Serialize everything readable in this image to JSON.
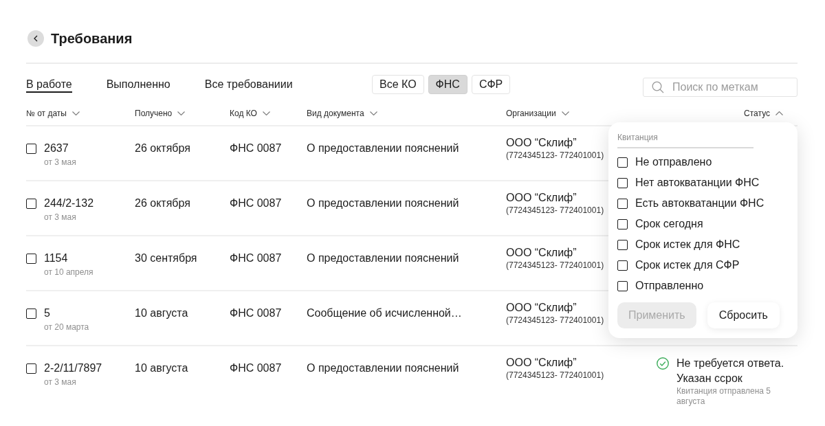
{
  "page": {
    "title": "Требования"
  },
  "tabs": [
    {
      "label": "В работе",
      "selected": true
    },
    {
      "label": "Выполненно",
      "selected": false
    },
    {
      "label": "Все требованиии",
      "selected": false
    }
  ],
  "authority_filter": [
    {
      "label": "Все КО",
      "selected": false
    },
    {
      "label": "ФНС",
      "selected": true
    },
    {
      "label": "СФР",
      "selected": false
    }
  ],
  "search": {
    "placeholder": "Поиск по меткам"
  },
  "table": {
    "columns": [
      {
        "label": "№ от даты",
        "expanded": false
      },
      {
        "label": "Получено",
        "expanded": false
      },
      {
        "label": "Код КО",
        "expanded": false
      },
      {
        "label": "Вид документа",
        "expanded": false
      },
      {
        "label": "Организации",
        "expanded": false
      },
      {
        "label": "Статус",
        "expanded": true
      }
    ],
    "rows": [
      {
        "checked": false,
        "number": "2637",
        "dated": "от 3 мая",
        "received": "26 октября",
        "code": "ФНС 0087",
        "document": "О предоставлении пояснений",
        "organization": "ООО “Склиф”",
        "tax_ids": "(7724345123- 772401001)"
      },
      {
        "checked": false,
        "number": "244/2-132",
        "dated": "от 3 мая",
        "received": "26 октября",
        "code": "ФНС 0087",
        "document": "О предоставлении пояснений",
        "organization": "ООО “Склиф”",
        "tax_ids": "(7724345123- 772401001)"
      },
      {
        "checked": false,
        "number": "1154",
        "dated": "от 10 апреля",
        "received": "30 сентября",
        "code": "ФНС 0087",
        "document": "О предоставлении пояснений",
        "organization": "ООО “Склиф”",
        "tax_ids": "(7724345123- 772401001)"
      },
      {
        "checked": false,
        "number": "5",
        "dated": "от 20 марта",
        "received": "10 августа",
        "code": "ФНС 0087",
        "document": "Сообщение об исчисленной…",
        "organization": "ООО “Склиф”",
        "tax_ids": "(7724345123- 772401001)"
      },
      {
        "checked": false,
        "number": "2-2/11/7897",
        "dated": "от 3 мая",
        "received": "10 августа",
        "code": "ФНС 0087",
        "document": "О предоставлении пояснений",
        "organization": "ООО “Склиф”",
        "tax_ids": "(7724345123- 772401001)",
        "status": {
          "kind": "done",
          "title": "Не требуется ответа. Указан ссрок",
          "note": "Квитанция отправлена 5 августа"
        }
      }
    ]
  },
  "status_filter": {
    "heading": "Квитанция",
    "options": [
      {
        "label": "Не отправлено",
        "checked": false
      },
      {
        "label": "Нет автокватанции ФНС",
        "checked": false
      },
      {
        "label": "Есть автокватанции ФНС",
        "checked": false
      },
      {
        "label": "Срок сегодня",
        "checked": false
      },
      {
        "label": "Срок истек для ФНС",
        "checked": false
      },
      {
        "label": "Срок истек для СФР",
        "checked": false
      },
      {
        "label": "Отправленно",
        "checked": false
      }
    ],
    "buttons": [
      {
        "label": "Применить",
        "disabled": true
      },
      {
        "label": "Сбросить",
        "disabled": false
      }
    ]
  }
}
